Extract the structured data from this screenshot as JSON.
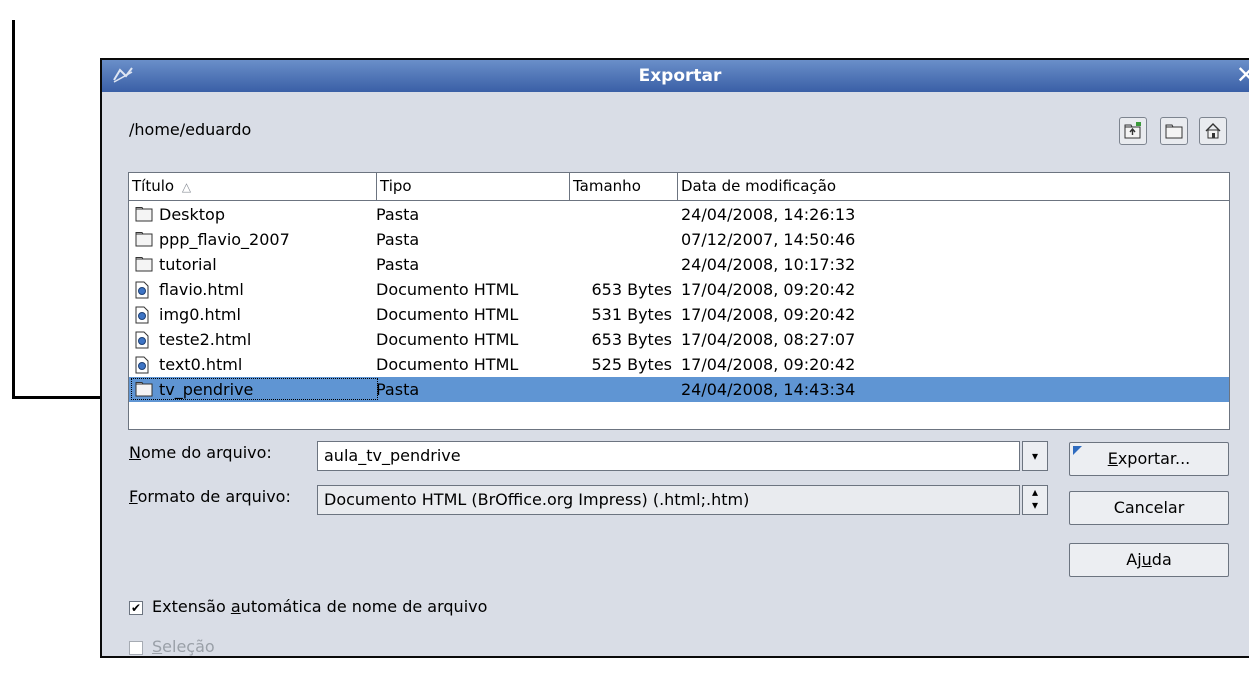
{
  "dialog": {
    "title": "Exportar",
    "close_glyph": "✕",
    "path": "/home/eduardo"
  },
  "toolbar": {
    "icons": [
      "folder-up-icon",
      "new-folder-icon",
      "home-icon"
    ]
  },
  "file_list": {
    "columns": [
      "Título",
      "Tipo",
      "Tamanho",
      "Data de modificação"
    ],
    "sort_indicator": "△",
    "rows": [
      {
        "name": "Desktop",
        "type": "Pasta",
        "size": "",
        "date": "24/04/2008, 14:26:13",
        "icon": "folder-icon"
      },
      {
        "name": "ppp_flavio_2007",
        "type": "Pasta",
        "size": "",
        "date": "07/12/2007, 14:50:46",
        "icon": "folder-icon"
      },
      {
        "name": "tutorial",
        "type": "Pasta",
        "size": "",
        "date": "24/04/2008, 10:17:32",
        "icon": "folder-icon"
      },
      {
        "name": "flavio.html",
        "type": "Documento HTML",
        "size": "653 Bytes",
        "date": "17/04/2008, 09:20:42",
        "icon": "html-document-icon"
      },
      {
        "name": "img0.html",
        "type": "Documento HTML",
        "size": "531 Bytes",
        "date": "17/04/2008, 09:20:42",
        "icon": "html-document-icon"
      },
      {
        "name": "teste2.html",
        "type": "Documento HTML",
        "size": "653 Bytes",
        "date": "17/04/2008, 08:27:07",
        "icon": "html-document-icon"
      },
      {
        "name": "text0.html",
        "type": "Documento HTML",
        "size": "525 Bytes",
        "date": "17/04/2008, 09:20:42",
        "icon": "html-document-icon"
      },
      {
        "name": "tv_pendrive",
        "type": "Pasta",
        "size": "",
        "date": "24/04/2008, 14:43:34",
        "icon": "folder-icon",
        "selected": true
      }
    ]
  },
  "form": {
    "filename_label_mnemonic": "N",
    "filename_label_rest": "ome do arquivo:",
    "filename_value": "aula_tv_pendrive",
    "format_label_mnemonic": "F",
    "format_label_rest": "ormato de arquivo:",
    "format_value": "Documento HTML (BrOffice.org Impress) (.html;.htm)"
  },
  "buttons": {
    "export_mnemonic": "E",
    "export_rest": "xportar...",
    "cancel": "Cancelar",
    "help_pre": "Aj",
    "help_mnemonic": "u",
    "help_post": "da"
  },
  "options": {
    "auto_ext_pre": "Extensão ",
    "auto_ext_mnemonic": "a",
    "auto_ext_post": "utomática de nome de arquivo",
    "auto_ext_checked": true,
    "selection_mnemonic": "S",
    "selection_rest": "eleção",
    "selection_checked": false,
    "selection_enabled": false
  },
  "colors": {
    "titlebar": "#4a72b6",
    "dialog_bg": "#d9dde6",
    "selection": "#5f95d3"
  }
}
